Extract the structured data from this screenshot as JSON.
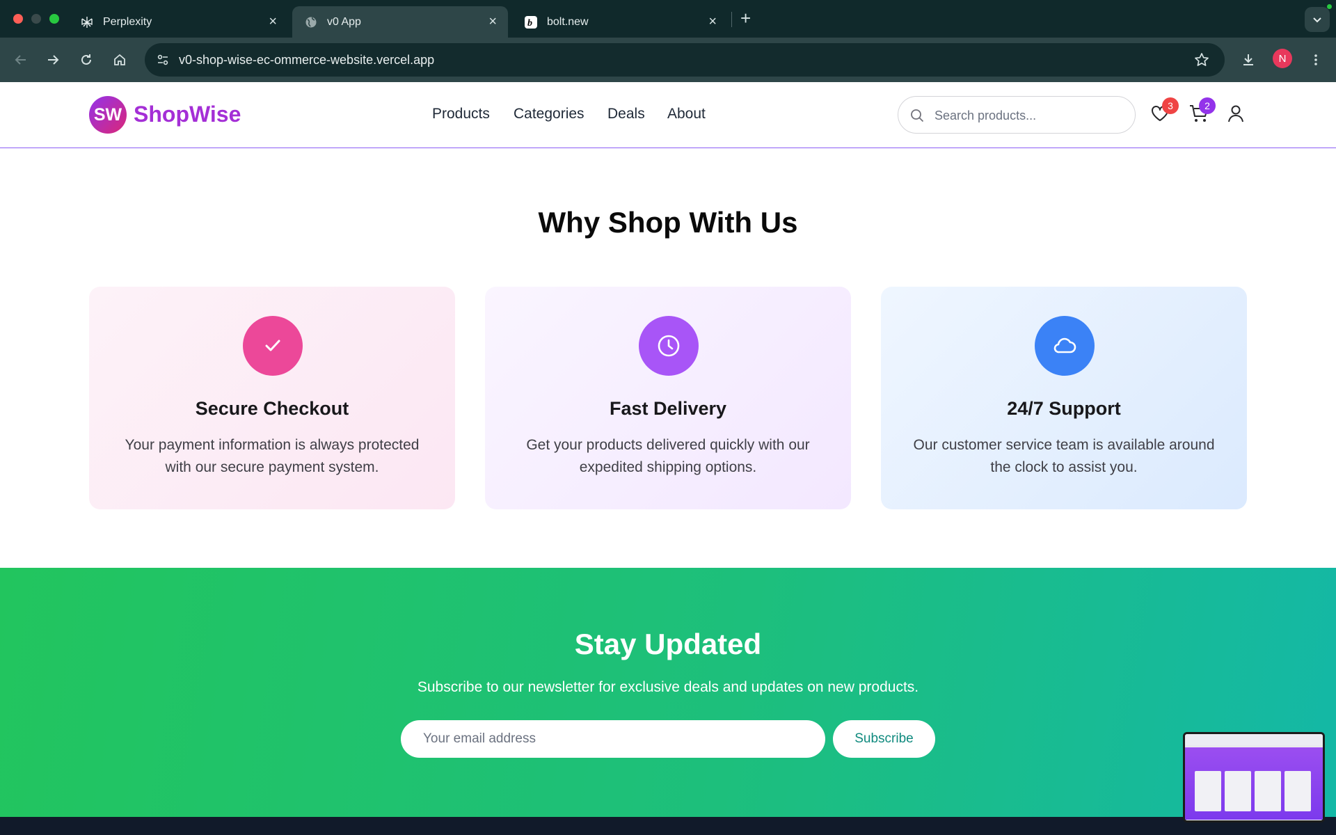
{
  "browser": {
    "tabs": [
      {
        "title": "Perplexity",
        "icon": "perplexity-icon",
        "active": false
      },
      {
        "title": "v0 App",
        "icon": "globe-icon",
        "active": true
      },
      {
        "title": "bolt.new",
        "icon": "bolt-icon",
        "active": false
      }
    ],
    "url": "v0-shop-wise-ec-ommerce-website.vercel.app",
    "profile_initial": "N"
  },
  "header": {
    "logo_mark": "SW",
    "logo_text": "ShopWise",
    "nav": [
      "Products",
      "Categories",
      "Deals",
      "About"
    ],
    "search_placeholder": "Search products...",
    "wishlist_count": "3",
    "cart_count": "2"
  },
  "features": {
    "title": "Why Shop With Us",
    "cards": [
      {
        "title": "Secure Checkout",
        "desc": "Your payment information is always protected with our secure payment system.",
        "icon": "check-icon",
        "color": "#ec4899"
      },
      {
        "title": "Fast Delivery",
        "desc": "Get your products delivered quickly with our expedited shipping options.",
        "icon": "clock-icon",
        "color": "#a855f7"
      },
      {
        "title": "24/7 Support",
        "desc": "Our customer service team is available around the clock to assist you.",
        "icon": "cloud-icon",
        "color": "#3b82f6"
      }
    ]
  },
  "newsletter": {
    "title": "Stay Updated",
    "subtitle": "Subscribe to our newsletter for exclusive deals and updates on new products.",
    "email_placeholder": "Your email address",
    "button": "Subscribe"
  },
  "colors": {
    "brand": "#a42fd6",
    "newsletter_start": "#22c55e",
    "newsletter_end": "#14b8a6"
  }
}
